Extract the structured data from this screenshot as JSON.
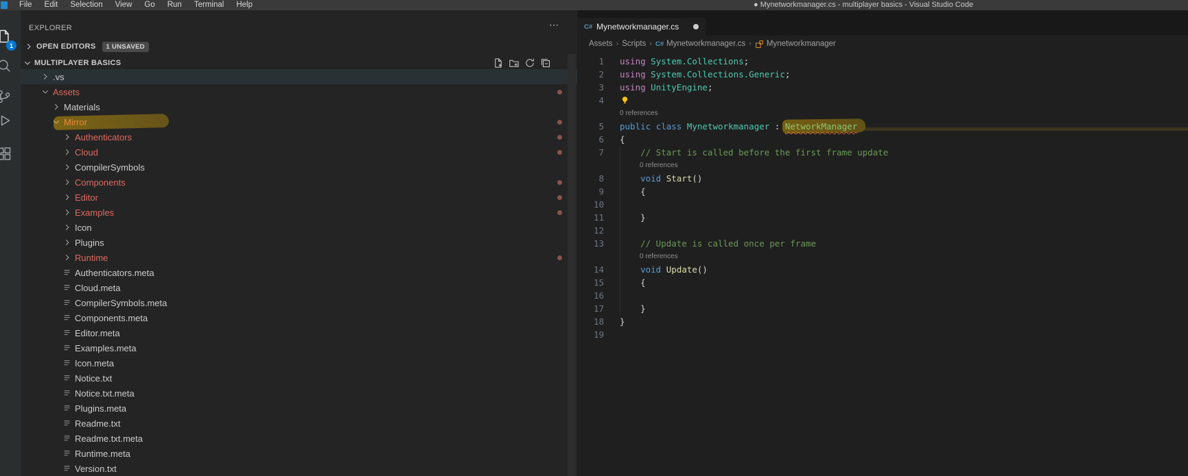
{
  "title_bar": {
    "logo_icon": "vscode-logo",
    "menus": [
      "File",
      "Edit",
      "Selection",
      "View",
      "Go",
      "Run",
      "Terminal",
      "Help"
    ],
    "window_title": "● Mynetworkmanager.cs - multiplayer basics - Visual Studio Code"
  },
  "activity_bar": {
    "badge": "1",
    "badge_color": "#0078d4",
    "icons": [
      {
        "name": "explorer",
        "active": true
      },
      {
        "name": "search",
        "active": false
      },
      {
        "name": "source-control",
        "active": false
      },
      {
        "name": "run-and-debug",
        "active": false
      },
      {
        "name": "extensions",
        "active": false
      }
    ]
  },
  "sidebar": {
    "title": "EXPLORER",
    "more_actions_icon": "ellipsis",
    "open_editors": {
      "label": "OPEN EDITORS",
      "badge": "1 UNSAVED"
    },
    "workspace": {
      "label": "MULTIPLAYER BASICS",
      "actions": [
        "new-file",
        "new-folder",
        "refresh",
        "collapse-all"
      ]
    },
    "colors": {
      "default": "#cccccc",
      "modified": "#de6a60",
      "dot": "#8a524b"
    },
    "tree": [
      {
        "label": ".vs",
        "kind": "folder",
        "level": 1,
        "expanded": false,
        "hover": true
      },
      {
        "label": "Assets",
        "kind": "folder",
        "level": 1,
        "expanded": true,
        "modified": true,
        "dot": true
      },
      {
        "label": "Materials",
        "kind": "folder",
        "level": 2,
        "expanded": false
      },
      {
        "label": "Mirror",
        "kind": "folder",
        "level": 2,
        "expanded": true,
        "modified": true,
        "dot": true,
        "highlight": true
      },
      {
        "label": "Authenticators",
        "kind": "folder",
        "level": 3,
        "expanded": false,
        "modified": true,
        "dot": true
      },
      {
        "label": "Cloud",
        "kind": "folder",
        "level": 3,
        "expanded": false,
        "modified": true,
        "dot": true
      },
      {
        "label": "CompilerSymbols",
        "kind": "folder",
        "level": 3,
        "expanded": false
      },
      {
        "label": "Components",
        "kind": "folder",
        "level": 3,
        "expanded": false,
        "modified": true,
        "dot": true
      },
      {
        "label": "Editor",
        "kind": "folder",
        "level": 3,
        "expanded": false,
        "modified": true,
        "dot": true
      },
      {
        "label": "Examples",
        "kind": "folder",
        "level": 3,
        "expanded": false,
        "modified": true,
        "dot": true
      },
      {
        "label": "Icon",
        "kind": "folder",
        "level": 3,
        "expanded": false
      },
      {
        "label": "Plugins",
        "kind": "folder",
        "level": 3,
        "expanded": false
      },
      {
        "label": "Runtime",
        "kind": "folder",
        "level": 3,
        "expanded": false,
        "modified": true,
        "dot": true
      },
      {
        "label": "Authenticators.meta",
        "kind": "file",
        "level": 3
      },
      {
        "label": "Cloud.meta",
        "kind": "file",
        "level": 3
      },
      {
        "label": "CompilerSymbols.meta",
        "kind": "file",
        "level": 3
      },
      {
        "label": "Components.meta",
        "kind": "file",
        "level": 3
      },
      {
        "label": "Editor.meta",
        "kind": "file",
        "level": 3
      },
      {
        "label": "Examples.meta",
        "kind": "file",
        "level": 3
      },
      {
        "label": "Icon.meta",
        "kind": "file",
        "level": 3
      },
      {
        "label": "Notice.txt",
        "kind": "file",
        "level": 3
      },
      {
        "label": "Notice.txt.meta",
        "kind": "file",
        "level": 3
      },
      {
        "label": "Plugins.meta",
        "kind": "file",
        "level": 3
      },
      {
        "label": "Readme.txt",
        "kind": "file",
        "level": 3
      },
      {
        "label": "Readme.txt.meta",
        "kind": "file",
        "level": 3
      },
      {
        "label": "Runtime.meta",
        "kind": "file",
        "level": 3
      },
      {
        "label": "Version.txt",
        "kind": "file",
        "level": 3
      }
    ]
  },
  "editor": {
    "tab": {
      "label": "Mynetworkmanager.cs",
      "icon": "csharp",
      "dirty": true
    },
    "breadcrumbs": [
      {
        "label": "Assets"
      },
      {
        "label": "Scripts"
      },
      {
        "label": "Mynetworkmanager.cs",
        "icon": "csharp"
      },
      {
        "label": "Mynetworkmanager",
        "icon": "symbol-class"
      }
    ],
    "code": {
      "token_colors": {
        "kwp": "#C586C0",
        "kwb": "#569CD6",
        "ty": "#4EC9B0",
        "pl": "#D4D4D4",
        "cm": "#6A9955",
        "me": "#DCDCAA"
      },
      "gutter_color": "#6e7681",
      "codelens_color": "#8f8f8f",
      "rows": [
        {
          "type": "line",
          "n": 1,
          "tokens": [
            [
              "using",
              "kwp"
            ],
            [
              " ",
              "pl"
            ],
            [
              "System.Collections",
              "ty"
            ],
            [
              ";",
              "pl"
            ]
          ]
        },
        {
          "type": "line",
          "n": 2,
          "tokens": [
            [
              "using",
              "kwp"
            ],
            [
              " ",
              "pl"
            ],
            [
              "System.Collections.Generic",
              "ty"
            ],
            [
              ";",
              "pl"
            ]
          ]
        },
        {
          "type": "line",
          "n": 3,
          "tokens": [
            [
              "using",
              "kwp"
            ],
            [
              " ",
              "pl"
            ],
            [
              "UnityEngine",
              "ty"
            ],
            [
              ";",
              "pl"
            ]
          ]
        },
        {
          "type": "line",
          "n": 4,
          "tokens": [],
          "bulb": true
        },
        {
          "type": "lens",
          "text": "0 references",
          "indent": 0
        },
        {
          "type": "line",
          "n": 5,
          "tokens": [
            [
              "public",
              "kwb"
            ],
            [
              " ",
              "pl"
            ],
            [
              "class",
              "kwb"
            ],
            [
              " ",
              "pl"
            ],
            [
              "Mynetworkmanager",
              "ty"
            ],
            [
              " : ",
              "pl"
            ],
            [
              "NetworkManager",
              "ty",
              "squiggle"
            ]
          ]
        },
        {
          "type": "line",
          "n": 6,
          "tokens": [
            [
              "{",
              "pl"
            ]
          ]
        },
        {
          "type": "line",
          "n": 7,
          "tokens": [
            [
              "    // Start is called before the first frame update",
              "cm"
            ]
          ]
        },
        {
          "type": "lens",
          "text": "0 references",
          "indent": 1
        },
        {
          "type": "line",
          "n": 8,
          "tokens": [
            [
              "    ",
              "pl"
            ],
            [
              "void",
              "kwb"
            ],
            [
              " ",
              "pl"
            ],
            [
              "Start",
              "me"
            ],
            [
              "()",
              "pl"
            ]
          ]
        },
        {
          "type": "line",
          "n": 9,
          "tokens": [
            [
              "    {",
              "pl"
            ]
          ]
        },
        {
          "type": "line",
          "n": 10,
          "tokens": []
        },
        {
          "type": "line",
          "n": 11,
          "tokens": [
            [
              "    }",
              "pl"
            ]
          ]
        },
        {
          "type": "line",
          "n": 12,
          "tokens": []
        },
        {
          "type": "line",
          "n": 13,
          "tokens": [
            [
              "    // Update is called once per frame",
              "cm"
            ]
          ]
        },
        {
          "type": "lens",
          "text": "0 references",
          "indent": 1
        },
        {
          "type": "line",
          "n": 14,
          "tokens": [
            [
              "    ",
              "pl"
            ],
            [
              "void",
              "kwb"
            ],
            [
              " ",
              "pl"
            ],
            [
              "Update",
              "me"
            ],
            [
              "()",
              "pl"
            ]
          ]
        },
        {
          "type": "line",
          "n": 15,
          "tokens": [
            [
              "    {",
              "pl"
            ]
          ]
        },
        {
          "type": "line",
          "n": 16,
          "tokens": []
        },
        {
          "type": "line",
          "n": 17,
          "tokens": [
            [
              "    }",
              "pl"
            ]
          ]
        },
        {
          "type": "line",
          "n": 18,
          "tokens": [
            [
              "}",
              "pl"
            ]
          ]
        },
        {
          "type": "line",
          "n": 19,
          "tokens": []
        }
      ]
    },
    "annotations": {
      "squiggle_color": "#c75c39",
      "marker_color": "rgba(255,196,0,0.35)",
      "lightbulb_color": "#f6c50d"
    }
  },
  "theme": {
    "titlebar_bg": "#3a3a3a",
    "activitybar_bg": "#2b2e2f",
    "sidebar_bg": "#242424",
    "editor_bg": "#1f1f1f",
    "tabstrip_bg": "#181818"
  }
}
